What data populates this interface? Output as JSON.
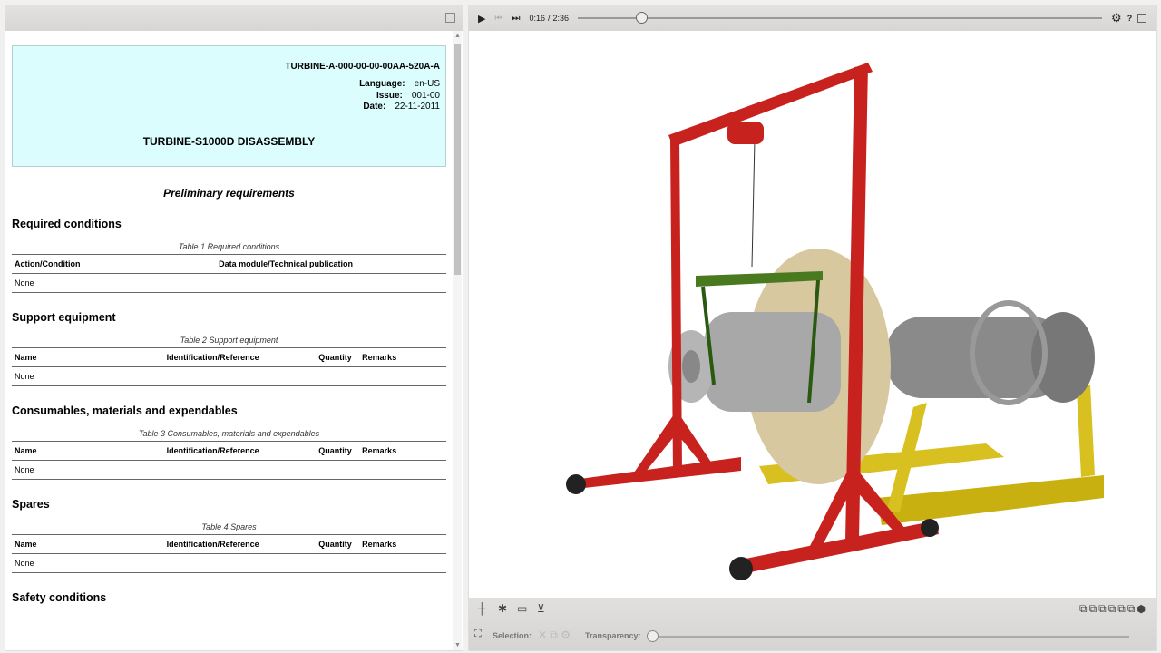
{
  "doc": {
    "code": "TURBINE-A-000-00-00-00AA-520A-A",
    "language_label": "Language:",
    "language": "en-US",
    "issue_label": "Issue:",
    "issue": "001-00",
    "date_label": "Date:",
    "date": "22-11-2011",
    "title": "TURBINE-S1000D DISASSEMBLY",
    "prelim": "Preliminary requirements",
    "sections": [
      {
        "heading": "Required conditions",
        "caption": "Table 1 Required conditions",
        "cols": [
          "Action/Condition",
          "Data module/Technical publication"
        ],
        "row": "None"
      },
      {
        "heading": "Support equipment",
        "caption": "Table 2 Support equipment",
        "cols": [
          "Name",
          "Identification/Reference",
          "Quantity",
          "Remarks"
        ],
        "row": "None"
      },
      {
        "heading": "Consumables, materials and expendables",
        "caption": "Table 3 Consumables, materials and expendables",
        "cols": [
          "Name",
          "Identification/Reference",
          "Quantity",
          "Remarks"
        ],
        "row": "None"
      },
      {
        "heading": "Spares",
        "caption": "Table 4 Spares",
        "cols": [
          "Name",
          "Identification/Reference",
          "Quantity",
          "Remarks"
        ],
        "row": "None"
      },
      {
        "heading": "Safety conditions"
      }
    ]
  },
  "player": {
    "current": "0:16",
    "sep": "/",
    "total": "2:36",
    "progress": 0.11
  },
  "bottom": {
    "selection": "Selection:",
    "transparency": "Transparency:",
    "transparency_value": 0
  }
}
